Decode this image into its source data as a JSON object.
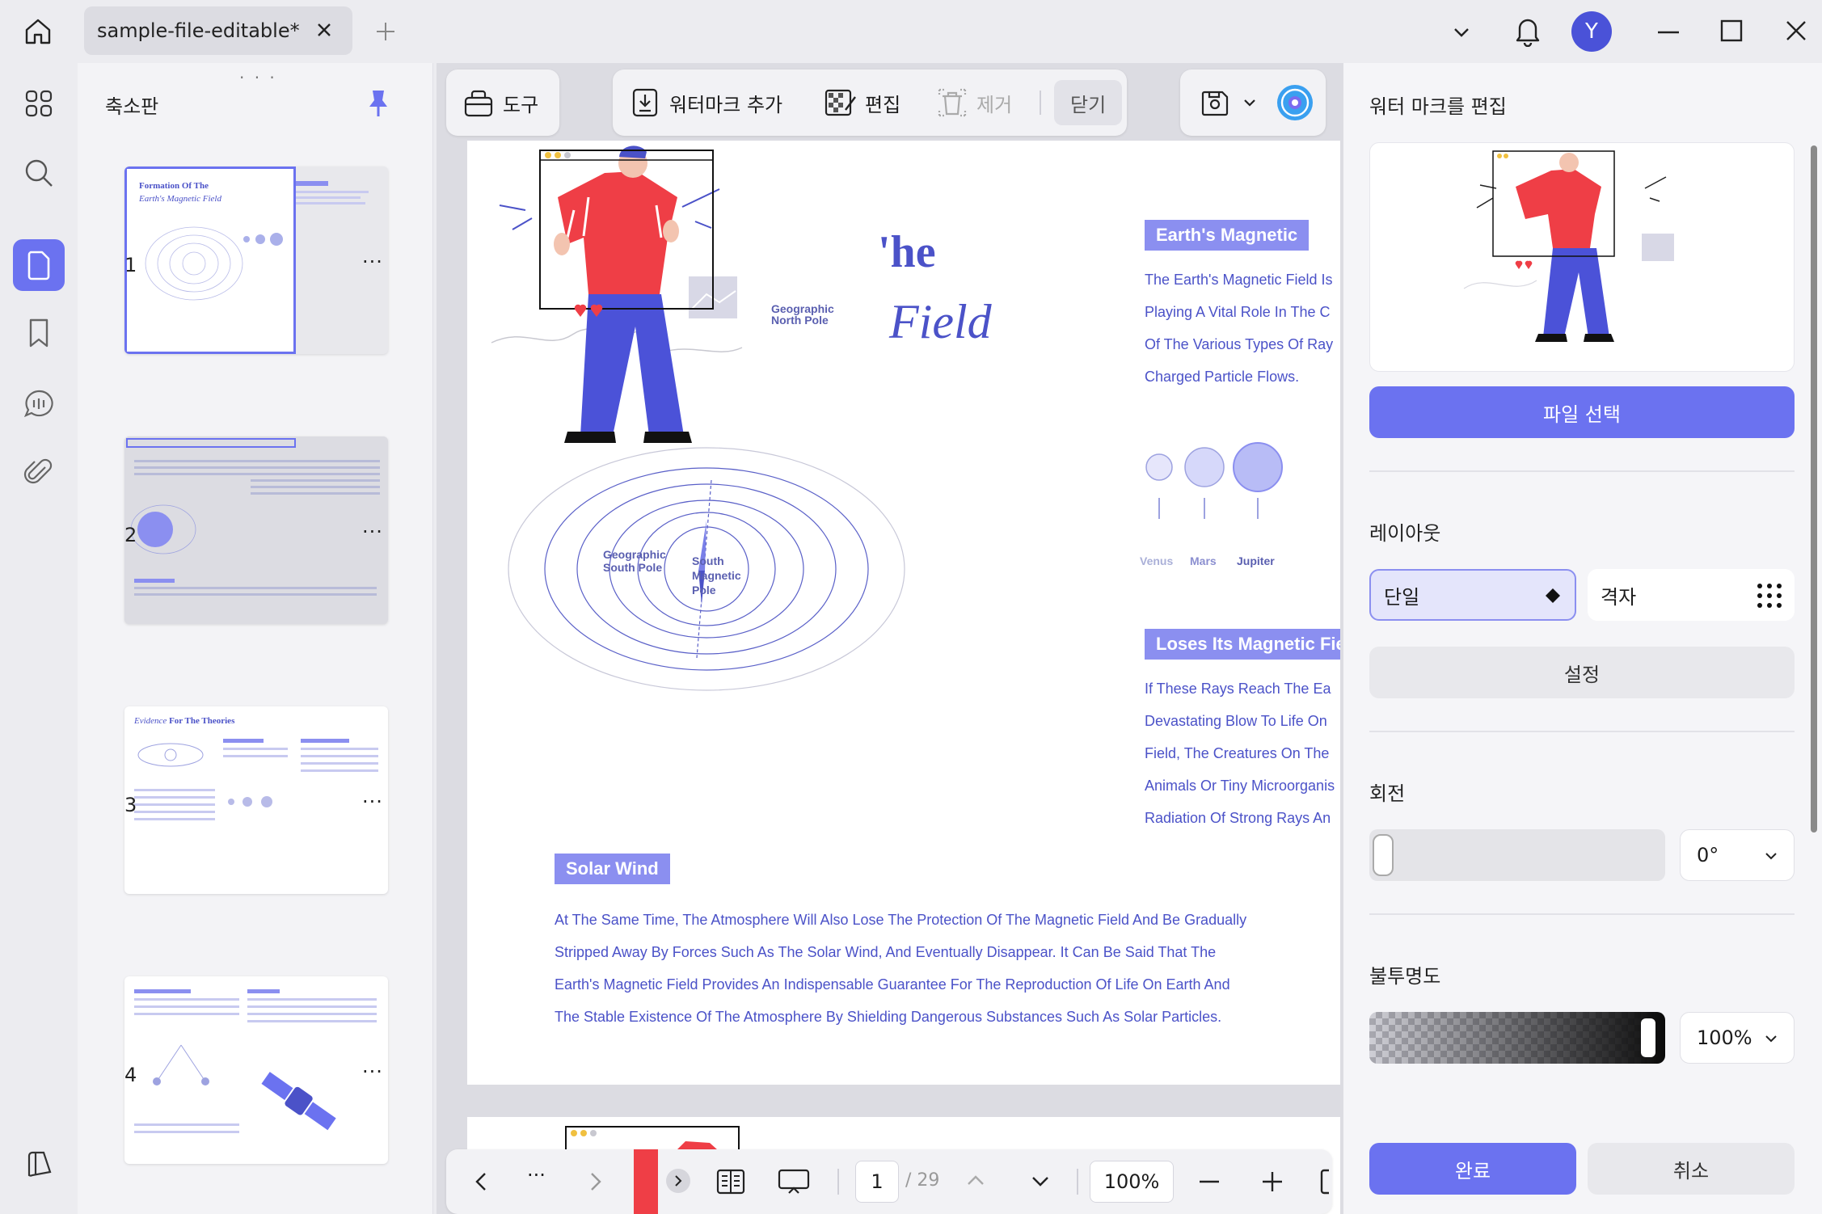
{
  "titlebar": {
    "tab_label": "sample-file-editable*",
    "avatar_letter": "Y"
  },
  "thumbnails": {
    "title": "축소판",
    "pages": [
      {
        "num": "1",
        "more": "···",
        "title_a": "Formation Of The",
        "title_b": "Earth's Magnetic Field"
      },
      {
        "num": "2",
        "more": "···"
      },
      {
        "num": "3",
        "more": "···",
        "title_a": "Evidence",
        "title_b": "For The Theories"
      },
      {
        "num": "4",
        "more": "···"
      }
    ]
  },
  "toolbar": {
    "tools_label": "도구",
    "add_watermark_label": "워터마크 추가",
    "edit_label": "편집",
    "remove_label": "제거",
    "close_label": "닫기"
  },
  "page": {
    "title_he": "'he",
    "title_field": "Field",
    "heading_earth": "Earth's Magnetic",
    "earth_lines": [
      "The Earth's Magnetic Field Is",
      "Playing A Vital Role In The C",
      "Of The Various Types Of Ray",
      "Charged Particle Flows."
    ],
    "north_pole": [
      "Geographic",
      "North Pole"
    ],
    "south_pole": [
      "Geographic",
      "South Pole"
    ],
    "south_magnetic": [
      "South",
      "Magnetic",
      "Pole"
    ],
    "planets": [
      "Venus",
      "Mars",
      "Jupiter"
    ],
    "heading_loses": "Loses Its Magnetic Fie",
    "loses_lines": [
      "If These Rays Reach The Ea",
      "Devastating Blow To Life On",
      "Field, The Creatures On The",
      "Animals Or Tiny Microorganis",
      "Radiation Of Strong Rays An"
    ],
    "heading_solar": "Solar Wind",
    "solar_lines": [
      "At The Same Time, The Atmosphere Will Also Lose The Protection Of The Magnetic Field And Be Gradually",
      "Stripped Away By Forces Such As The Solar Wind, And Eventually Disappear. It Can Be Said That The",
      "Earth's Magnetic Field Provides An Indispensable Guarantee For The Reproduction Of Life On Earth And",
      "The Stable Existence Of The Atmosphere By Shielding Dangerous Substances Such As Solar Particles."
    ]
  },
  "bottombar": {
    "current_page": "1",
    "total_pages": "/ 29",
    "zoom": "100%"
  },
  "panel": {
    "title": "워터 마크를 편집",
    "select_file": "파일 선택",
    "layout_label": "레이아웃",
    "layout_single": "단일",
    "layout_grid": "격자",
    "settings": "설정",
    "rotation_label": "회전",
    "rotation_value": "0°",
    "opacity_label": "불투명도",
    "opacity_value": "100%",
    "done": "완료",
    "cancel": "취소"
  },
  "colors": {
    "accent": "#6b72f0",
    "page_text": "#4b52c8",
    "heading_bg": "#8b8ff0"
  }
}
